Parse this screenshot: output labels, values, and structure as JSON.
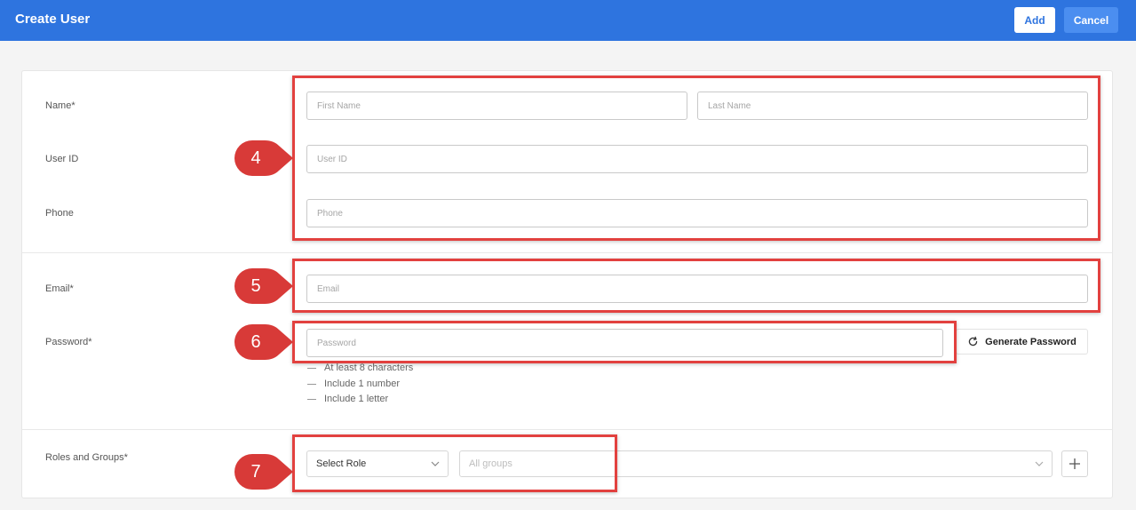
{
  "header": {
    "title": "Create User",
    "add_label": "Add",
    "cancel_label": "Cancel"
  },
  "form": {
    "name_label": "Name*",
    "first_name_placeholder": "First Name",
    "last_name_placeholder": "Last Name",
    "user_id_label": "User ID",
    "user_id_placeholder": "User ID",
    "phone_label": "Phone",
    "phone_placeholder": "Phone",
    "email_label": "Email*",
    "email_placeholder": "Email",
    "password_label": "Password*",
    "password_placeholder": "Password",
    "generate_password_label": "Generate Password",
    "password_rules": [
      "At least 8 characters",
      "Include 1 number",
      "Include 1 letter"
    ],
    "roles_label": "Roles and Groups*",
    "role_select_value": "Select Role",
    "groups_select_value": "All groups"
  },
  "annotations": [
    "4",
    "5",
    "6",
    "7"
  ],
  "colors": {
    "header_bg": "#2e74df",
    "highlight": "#e2413f",
    "marker": "#d83a38"
  }
}
